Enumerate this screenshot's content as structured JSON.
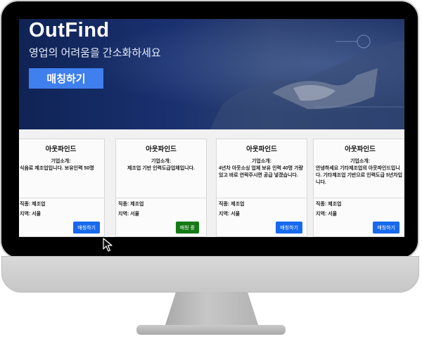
{
  "hero": {
    "title": "OutFind",
    "subtitle": "영업의 어려움을 간소화하세요",
    "cta_label": "매칭하기"
  },
  "cards": [
    {
      "company": "아웃파인드",
      "intro_label": "기업소개:",
      "intro": "식음료 제조업입니다. 보유인력 50명",
      "industry": "직종: 제조업",
      "region": "지역: 서울",
      "button_label": "매칭하기",
      "button_state": "default"
    },
    {
      "company": "아웃파인드",
      "intro_label": "기업소개:",
      "intro": "제조업 기반 인력도급업체입니다.",
      "industry": "직종: 제조업",
      "region": "지역: 서울",
      "button_label": "매칭 중",
      "button_state": "active"
    },
    {
      "company": "아웃파인드",
      "intro_label": "기업소개:",
      "intro": "4년차 아웃소싱 업체 보유 인력 40명 가량 있고 바로 연락주시면 공급 넣겠습니다.",
      "industry": "직종: 제조업",
      "region": "지역: 서울",
      "button_label": "매칭하기",
      "button_state": "default"
    },
    {
      "company": "아웃파인드",
      "intro_label": "기업소개:",
      "intro": "안녕하세요 기타제조업의 아웃파인드입니다. 기타제조업 기반으로 인력도급 5년차입니다.",
      "industry": "직종: 제조업",
      "region": "지역: 서울",
      "button_label": "매칭하기",
      "button_state": "default"
    }
  ],
  "colors": {
    "hero_button": "#3f7fee",
    "match_button": "#1769ee",
    "matching_button": "#147a14"
  },
  "icons": [
    "mouse-cursor-icon"
  ]
}
